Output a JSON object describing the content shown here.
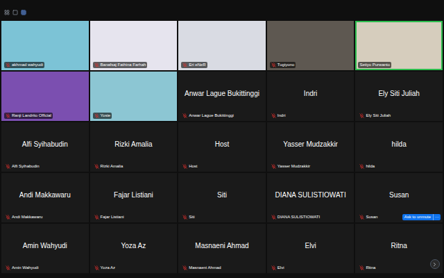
{
  "participants": [
    {
      "name": "akhmad wahyudi",
      "kind": "video",
      "muted": true,
      "selected": false
    },
    {
      "name": "Banafsaj Fathina Farhah",
      "kind": "video",
      "muted": true,
      "selected": false
    },
    {
      "name": "Eri eNeR",
      "kind": "video",
      "muted": true,
      "selected": false
    },
    {
      "name": "Tugiyono",
      "kind": "video",
      "muted": true,
      "selected": false
    },
    {
      "name": "Setiyo Purwanto",
      "kind": "video",
      "muted": false,
      "selected": true
    },
    {
      "name": "Ranji Landrito Official",
      "kind": "video",
      "muted": true,
      "selected": false
    },
    {
      "name": "Yosie",
      "kind": "video",
      "muted": true,
      "selected": false
    },
    {
      "name": "Anwar Lague Bukittinggi",
      "kind": "name",
      "muted": true,
      "selected": false
    },
    {
      "name": "Indri",
      "kind": "name",
      "muted": true,
      "selected": false
    },
    {
      "name": "Ely Siti Juliah",
      "kind": "name",
      "muted": true,
      "selected": false
    },
    {
      "name": "Alfi Syihabudin",
      "kind": "name",
      "muted": true,
      "selected": false
    },
    {
      "name": "Rizki Amalia",
      "kind": "name",
      "muted": true,
      "selected": false
    },
    {
      "name": "Host",
      "kind": "name",
      "muted": true,
      "selected": false
    },
    {
      "name": "Yasser Mudzakkir",
      "kind": "name",
      "muted": true,
      "selected": false
    },
    {
      "name": "hilda",
      "kind": "name",
      "muted": true,
      "selected": false
    },
    {
      "name": "Andi Makkawaru",
      "kind": "name",
      "muted": true,
      "selected": false
    },
    {
      "name": "Fajar Listiani",
      "kind": "name",
      "muted": true,
      "selected": false
    },
    {
      "name": "Siti",
      "kind": "name",
      "muted": true,
      "selected": false
    },
    {
      "name": "DIANA SULISTIOWATI",
      "kind": "name",
      "muted": true,
      "selected": false
    },
    {
      "name": "Susan",
      "kind": "name",
      "muted": true,
      "selected": false
    },
    {
      "name": "Amin Wahyudi",
      "kind": "name",
      "muted": true,
      "selected": false
    },
    {
      "name": "Yoza Az",
      "kind": "name",
      "muted": true,
      "selected": false
    },
    {
      "name": "Masnaeni Ahmad",
      "kind": "name",
      "muted": true,
      "selected": false
    },
    {
      "name": "Elvi",
      "kind": "name",
      "muted": true,
      "selected": false
    },
    {
      "name": "Ritna",
      "kind": "name",
      "muted": true,
      "selected": false
    }
  ],
  "ask_to_unmute": {
    "label": "Ask to unmute",
    "more": "···"
  }
}
